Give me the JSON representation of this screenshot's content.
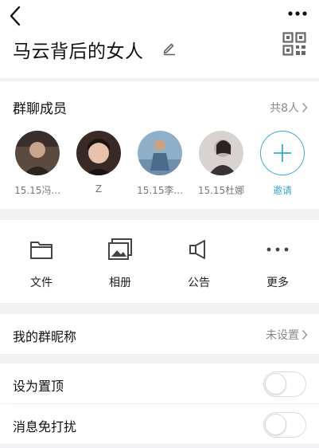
{
  "header": {
    "title": "马云背后的女人",
    "icons": [
      "back-icon",
      "more-icon",
      "edit-icon",
      "qr-code-icon"
    ]
  },
  "members": {
    "title": "群聊成员",
    "count": "共8人",
    "list": [
      {
        "name": "15.15冯...",
        "avatar_color": "#5b4a3f"
      },
      {
        "name": "Z",
        "avatar_color": "#3a2a26"
      },
      {
        "name": "15.15李...",
        "avatar_color": "#6e8eaa"
      },
      {
        "name": "15.15杜娜",
        "avatar_color": "#b9b2b0"
      }
    ],
    "invite_label": "邀请"
  },
  "actions": [
    {
      "label": "文件",
      "icon": "folder-icon"
    },
    {
      "label": "相册",
      "icon": "album-icon"
    },
    {
      "label": "公告",
      "icon": "megaphone-icon"
    },
    {
      "label": "更多",
      "icon": "more-dots-icon"
    }
  ],
  "nickname": {
    "label": "我的群昵称",
    "value": "未设置"
  },
  "settings": [
    {
      "label": "设为置顶",
      "on": false
    },
    {
      "label": "消息免打扰",
      "on": false
    }
  ],
  "colors": {
    "accent": "#3aa8cf",
    "background": "#f1f1f3",
    "secondary_text": "#888888"
  }
}
